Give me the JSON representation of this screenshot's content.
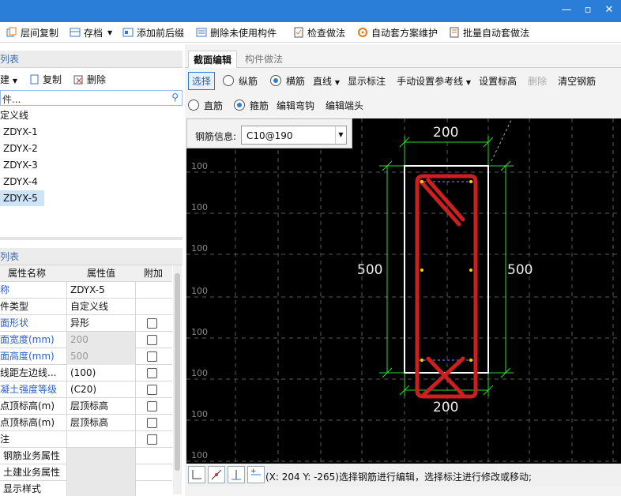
{
  "toolbar": {
    "items": [
      {
        "label": "层间复制",
        "icon": "layer-copy-icon"
      },
      {
        "label": "存档",
        "icon": "archive-icon"
      },
      {
        "label": "添加前后缀",
        "icon": "add-prefix-suffix-icon"
      },
      {
        "label": "删除未使用构件",
        "icon": "delete-unused-icon"
      },
      {
        "label": "检查做法",
        "icon": "check-method-icon"
      },
      {
        "label": "自动套方案维护",
        "icon": "auto-scheme-icon"
      },
      {
        "label": "批量自动套做法",
        "icon": "batch-auto-icon"
      }
    ]
  },
  "left": {
    "list_header": "列表",
    "tools": {
      "new": "建",
      "copy": "复制",
      "delete": "删除"
    },
    "search_placeholder": "件...",
    "tree": {
      "root": "定义线",
      "items": [
        "ZDYX-1",
        "ZDYX-2",
        "ZDYX-3",
        "ZDYX-4",
        "ZDYX-5"
      ],
      "selected": "ZDYX-5"
    },
    "prop_header": "列表",
    "prop_columns": [
      "属性名称",
      "属性值",
      "附加"
    ],
    "props": [
      {
        "name": "称",
        "value": "ZDYX-5",
        "check": false,
        "blue": true,
        "gray": false
      },
      {
        "name": "件类型",
        "value": "自定义线",
        "check": false,
        "blue": false,
        "gray": false
      },
      {
        "name": "面形状",
        "value": "异形",
        "check": true,
        "blue": true,
        "gray": false
      },
      {
        "name": "面宽度(mm)",
        "value": "200",
        "check": true,
        "blue": true,
        "gray": true
      },
      {
        "name": "面高度(mm)",
        "value": "500",
        "check": true,
        "blue": true,
        "gray": true
      },
      {
        "name": "线距左边线...",
        "value": "(100)",
        "check": true,
        "blue": false,
        "gray": false
      },
      {
        "name": "凝土强度等级",
        "value": "(C20)",
        "check": true,
        "blue": true,
        "gray": false
      },
      {
        "name": "点顶标高(m)",
        "value": "层顶标高",
        "check": true,
        "blue": false,
        "gray": false
      },
      {
        "name": "点顶标高(m)",
        "value": "层顶标高",
        "check": true,
        "blue": false,
        "gray": false
      },
      {
        "name": "注",
        "value": "",
        "check": true,
        "blue": false,
        "gray": false
      },
      {
        "name": "钢筋业务属性",
        "value": "",
        "check": false,
        "blue": false,
        "gray": false
      },
      {
        "name": "土建业务属性",
        "value": "",
        "check": false,
        "blue": false,
        "gray": false
      },
      {
        "name": "显示样式",
        "value": "",
        "check": false,
        "blue": false,
        "gray": false
      }
    ]
  },
  "right": {
    "tabs": [
      "截面编辑",
      "构件做法"
    ],
    "row1": {
      "select": "选择",
      "longitudinal": "纵筋",
      "transverse": "横筋",
      "line": "直线",
      "show_dim": "显示标注",
      "manual_ref": "手动设置参考线",
      "set_elev": "设置标高",
      "delete": "删除",
      "clear": "清空钢筋"
    },
    "row2": {
      "straight": "直筋",
      "stirrup": "箍筋",
      "edit_hook": "编辑弯钩",
      "edit_end": "编辑端头"
    },
    "rebar_info_label": "钢筋信息:",
    "rebar_info_value": "C10@190",
    "grid_labels": [
      "100",
      "100",
      "100",
      "100",
      "100",
      "100",
      "100",
      "100"
    ],
    "dims": {
      "top": "200",
      "bottom": "200",
      "left": "500",
      "right": "500"
    },
    "status_text": "(X: 204 Y: -265)选择钢筋进行编辑，选择标注进行修改或移动;"
  }
}
